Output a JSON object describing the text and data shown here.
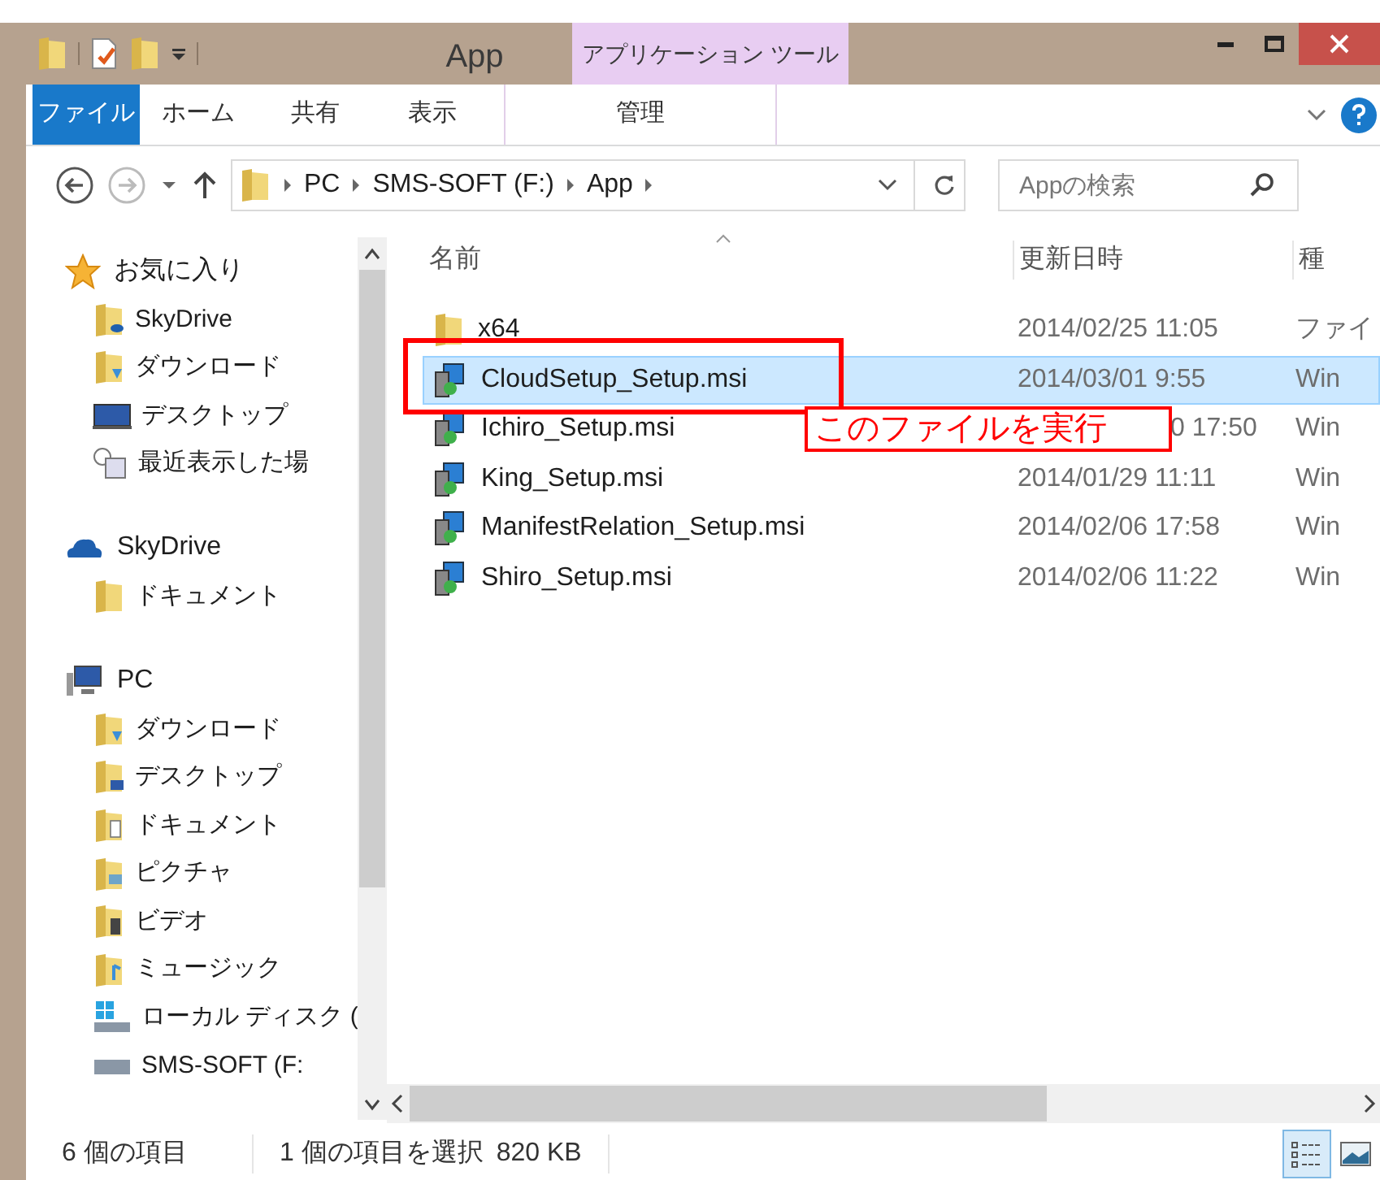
{
  "window": {
    "title": "App",
    "context_tab": "アプリケーション ツール"
  },
  "ribbon_tabs": [
    {
      "label": "ファイル",
      "selected": true
    },
    {
      "label": "ホーム",
      "selected": false
    },
    {
      "label": "共有",
      "selected": false
    },
    {
      "label": "表示",
      "selected": false
    },
    {
      "label": "管理",
      "selected": false
    }
  ],
  "address": {
    "crumbs": [
      "PC",
      "SMS-SOFT (F:)",
      "App"
    ]
  },
  "search": {
    "placeholder": "Appの検索"
  },
  "sidebar": {
    "items": [
      {
        "label": "お気に入り",
        "children": [
          {
            "label": "SkyDrive"
          },
          {
            "label": "ダウンロード"
          },
          {
            "label": "デスクトップ"
          },
          {
            "label": "最近表示した場"
          }
        ]
      },
      {
        "label": "SkyDrive",
        "children": [
          {
            "label": "ドキュメント"
          }
        ]
      },
      {
        "label": "PC",
        "children": [
          {
            "label": "ダウンロード"
          },
          {
            "label": "デスクトップ"
          },
          {
            "label": "ドキュメント"
          },
          {
            "label": "ピクチャ"
          },
          {
            "label": "ビデオ"
          },
          {
            "label": "ミュージック"
          },
          {
            "label": "ローカル ディスク ("
          },
          {
            "label": "SMS-SOFT (F:"
          }
        ]
      }
    ]
  },
  "table": {
    "columns": [
      "名前",
      "更新日時",
      "種"
    ],
    "rows": [
      {
        "kind": "folder",
        "name": "x64",
        "date": "2014/02/25 11:05",
        "type": "ファイ",
        "selected": false,
        "covered": false
      },
      {
        "kind": "msi",
        "name": "CloudSetup_Setup.msi",
        "date": "2014/03/01 9:55",
        "type": "Win",
        "selected": true,
        "covered": false
      },
      {
        "kind": "msi",
        "name": "Ichiro_Setup.msi",
        "date": "0 17:50",
        "type": "Win",
        "selected": false,
        "covered": true,
        "callout": "このファイルを実行"
      },
      {
        "kind": "msi",
        "name": "King_Setup.msi",
        "date": "2014/01/29 11:11",
        "type": "Win",
        "selected": false,
        "covered": false
      },
      {
        "kind": "msi",
        "name": "ManifestRelation_Setup.msi",
        "date": "2014/02/06 17:58",
        "type": "Win",
        "selected": false,
        "covered": false
      },
      {
        "kind": "msi",
        "name": "Shiro_Setup.msi",
        "date": "2014/02/06 11:22",
        "type": "Win",
        "selected": false,
        "covered": false
      }
    ]
  },
  "status_bar": {
    "count": "6 個の項目",
    "selection": "1 個の項目を選択",
    "size": "820 KB",
    "views": [
      {
        "selected": true
      },
      {
        "selected": false
      }
    ]
  }
}
